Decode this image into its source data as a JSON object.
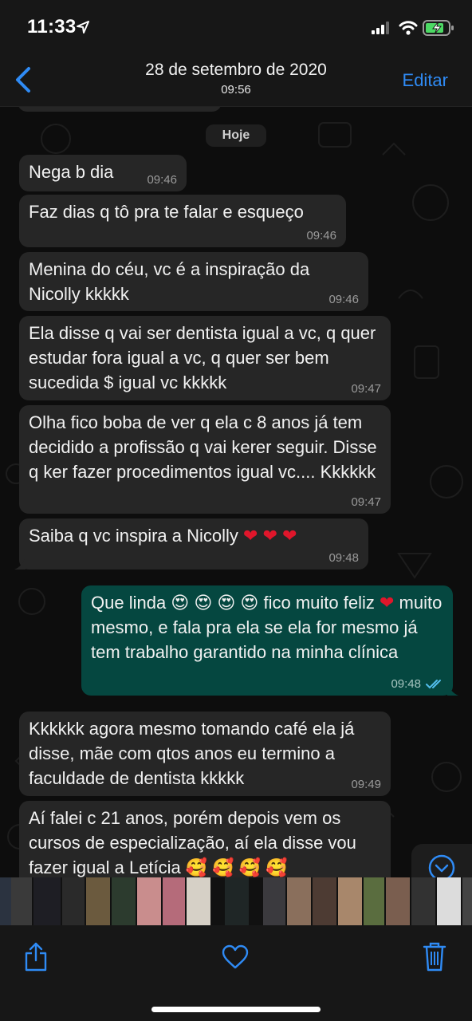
{
  "status_bar": {
    "time": "11:33",
    "icons": [
      "location-arrow-icon",
      "signal-icon",
      "wifi-icon",
      "battery-charging-icon"
    ]
  },
  "nav": {
    "title": "28 de setembro de 2020",
    "subtitle": "09:56",
    "edit_label": "Editar",
    "back_icon": "chevron-left-icon"
  },
  "chat": {
    "date_chip": "Hoje",
    "messages": [
      {
        "direction": "in",
        "text": "Nega b dia",
        "time": "09:46"
      },
      {
        "direction": "in",
        "text": "Faz dias q tô pra te falar e esqueço",
        "time": "09:46"
      },
      {
        "direction": "in",
        "text": "Menina do céu, vc é a inspiração da Nicolly kkkkk",
        "time": "09:46"
      },
      {
        "direction": "in",
        "text": "Ela disse q vai ser dentista igual a vc, q quer estudar fora igual a vc, q quer ser bem sucedida $ igual vc kkkkk",
        "time": "09:47"
      },
      {
        "direction": "in",
        "text": "Olha fico boba de ver q ela c 8 anos já tem decidido a profissão q vai kerer seguir. Disse q ker fazer procedimentos igual vc.... Kkkkkk",
        "time": "09:47"
      },
      {
        "direction": "in",
        "text": "Saiba q vc inspira a Nicolly ❤️ ❤️ ❤️",
        "time": "09:48"
      },
      {
        "direction": "out",
        "text": "Que linda 😍 😍 😍 😍 fico muito feliz ❤️ muito mesmo, e fala pra ela se ela for mesmo já tem trabalho garantido na minha clínica",
        "time": "09:48",
        "status": "read"
      },
      {
        "direction": "in",
        "text": "Kkkkkk agora mesmo tomando café ela já disse, mãe com qtos anos eu termino a faculdade de dentista kkkkk",
        "time": "09:49"
      },
      {
        "direction": "in",
        "text": "Aí falei c 21 anos, porém depois vem os cursos de especialização, aí ela disse vou fazer igual a Letícia 🥰 🥰 🥰 🥰",
        "time": ""
      }
    ]
  },
  "toolbar": {
    "share_icon": "share-icon",
    "favorite_icon": "heart-icon",
    "delete_icon": "trash-icon"
  },
  "colors": {
    "accent": "#2f8bf5",
    "incoming_bubble": "#262626",
    "outgoing_bubble": "#054740",
    "read_ticks": "#53bdeb"
  }
}
